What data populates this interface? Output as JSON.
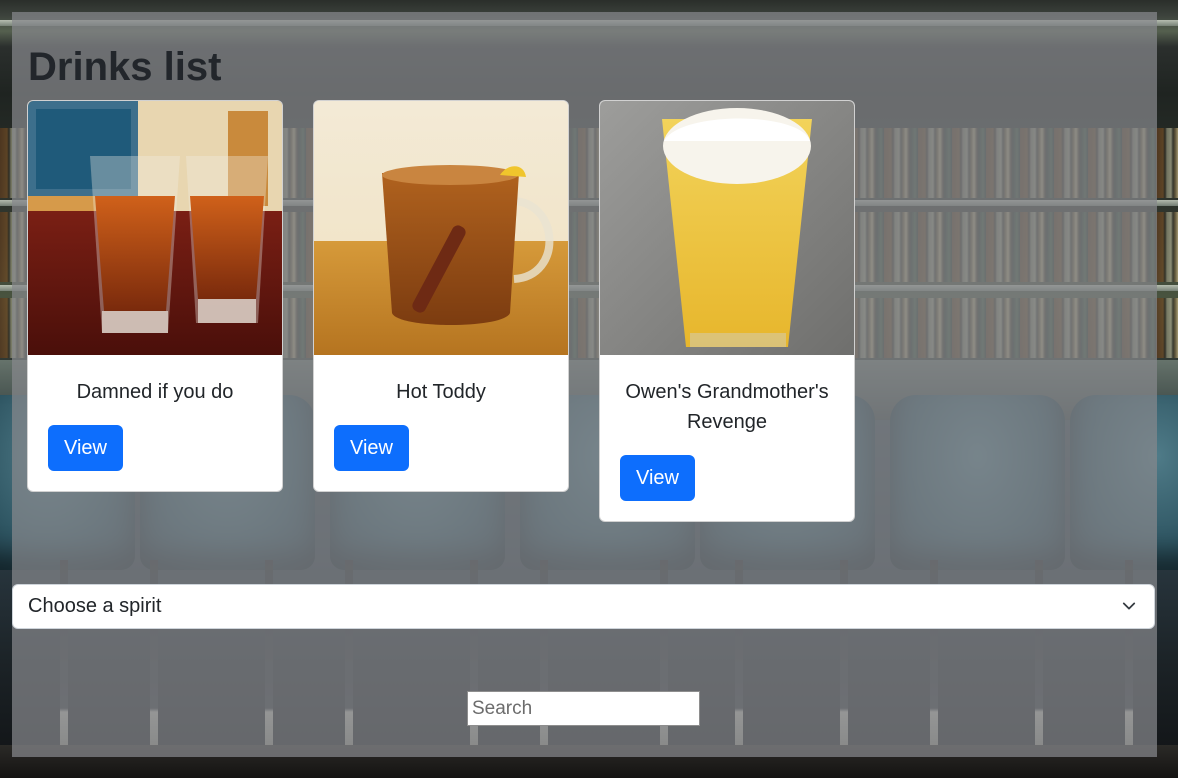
{
  "page": {
    "title": "Drinks list"
  },
  "drinks": [
    {
      "name": "Damned if you do",
      "button_label": "View",
      "image_icon": "shot-glasses-image"
    },
    {
      "name": "Hot Toddy",
      "button_label": "View",
      "image_icon": "hot-toddy-mug-image"
    },
    {
      "name": "Owen's Grandmother's Revenge",
      "button_label": "View",
      "image_icon": "pint-glass-image"
    }
  ],
  "filters": {
    "spirit_select_value": "Choose a spirit",
    "search_placeholder": "Search"
  },
  "colors": {
    "primary_button": "#0d6efd",
    "overlay": "#87888c"
  }
}
